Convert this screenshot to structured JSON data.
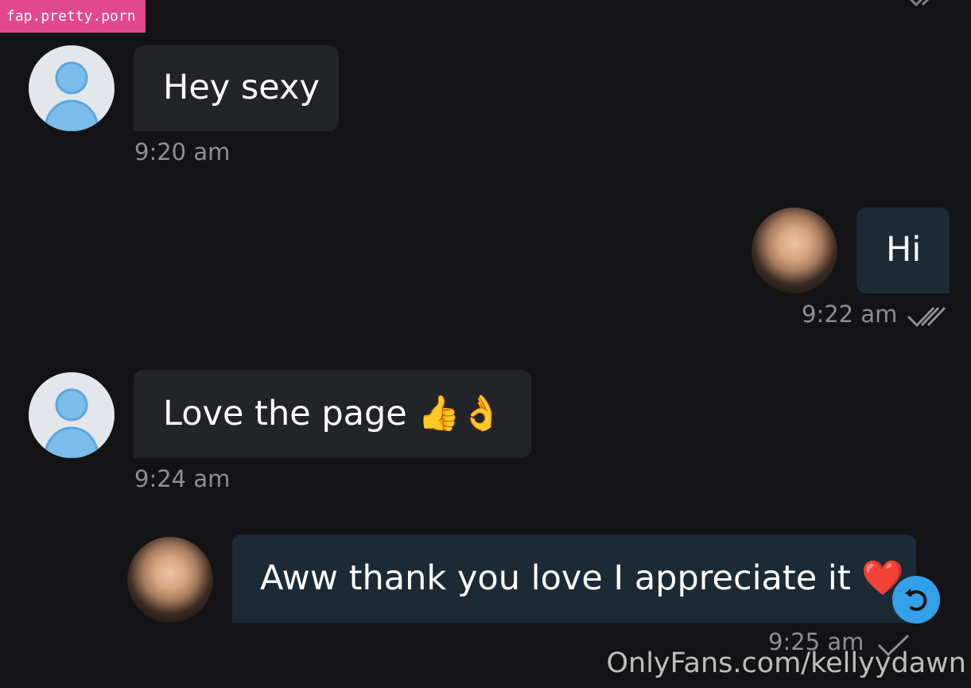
{
  "watermark_top": "fap.pretty.porn",
  "watermark_bottom": "OnlyFans.com/kellyydawn",
  "messages": [
    {
      "text": "Hey sexy",
      "time": "9:20 am"
    },
    {
      "text": "Hi",
      "time": "9:22 am",
      "status": "read"
    },
    {
      "text": "Love the page 👍👌",
      "time": "9:24 am"
    },
    {
      "text": "Aww thank you love I appreciate it ❤️",
      "time": "9:25 am",
      "status": "sent"
    }
  ],
  "colors": {
    "background": "#131315",
    "incoming_bubble": "#222428",
    "outgoing_bubble": "#1c2a35",
    "timestamp": "#8c8f94",
    "accent": "#33a0e8",
    "watermark_badge": "#e1488d"
  },
  "icons": {
    "read_receipt": "double-check-icon",
    "sent_receipt": "single-check-icon",
    "undo": "undo-icon"
  }
}
